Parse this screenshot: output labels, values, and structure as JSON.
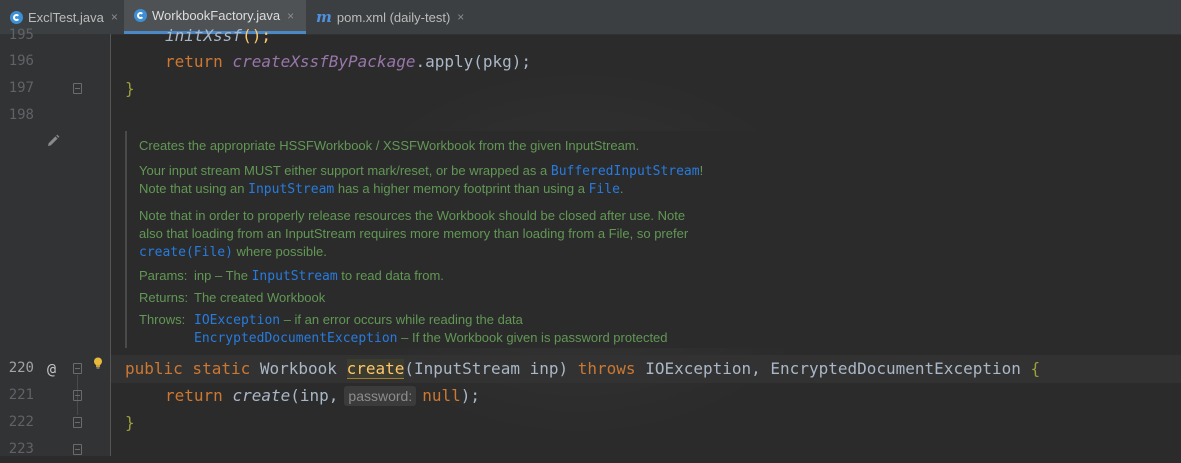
{
  "tabs": [
    {
      "label": "ExclTest.java",
      "icon": "java-class-icon",
      "active": false
    },
    {
      "label": "WorkbookFactory.java",
      "icon": "java-class-icon",
      "active": true
    },
    {
      "label": "pom.xml (daily-test)",
      "icon": "maven-icon",
      "active": false
    }
  ],
  "tab_close": "×",
  "maven_glyph": "m",
  "lines": {
    "l195": "195",
    "l196": "196",
    "l197": "197",
    "l198": "198",
    "l220": "220",
    "l221": "221",
    "l222": "222",
    "l223": "223"
  },
  "code": {
    "c195_fn": "initXssf",
    "c195_rest": "();",
    "c196_kw": "return ",
    "c196_fn": "createXssfByPackage",
    "c196_rest": ".apply(pkg);",
    "c197": "}",
    "c220_kw1": "public static ",
    "c220_type": "Workbook ",
    "c220_method": "create",
    "c220_params": "(InputStream inp) ",
    "c220_throws": "throws ",
    "c220_ex": "IOException, EncryptedDocumentException ",
    "c220_brace": "{",
    "c221_kw": "return ",
    "c221_call": "create",
    "c221_args": "(inp,",
    "c221_hint": "password:",
    "c221_null": "null",
    "c221_end": ");",
    "c222": "}"
  },
  "gutter": {
    "override_marker": "@"
  },
  "doc": {
    "line1": "Creates the appropriate HSSFWorkbook / XSSFWorkbook from the given InputStream.",
    "line2a": "Your input stream MUST either support mark/reset, or be wrapped as a ",
    "line2b": "BufferedInputStream",
    "line2c": "!",
    "line3a": "Note that using an ",
    "line3b": "InputStream",
    "line3c": " has a higher memory footprint than using a ",
    "line3d": "File",
    "line3e": ".",
    "line4": "Note that in order to properly release resources the Workbook should be closed after use. Note",
    "line5": "also that loading from an InputStream requires more memory than loading from a File, so prefer",
    "line6a": "create(File)",
    "line6b": " where possible.",
    "params_label": "Params:",
    "params_a": "inp – The ",
    "params_b": "InputStream",
    "params_c": " to read data from.",
    "returns_label": "Returns:",
    "returns_text": "The created Workbook",
    "throws_label": "Throws:",
    "throws1a": "IOException",
    "throws1b": " – if an error occurs while reading the data",
    "throws2a": "EncryptedDocumentException",
    "throws2b": " – If the Workbook given is password protected"
  }
}
